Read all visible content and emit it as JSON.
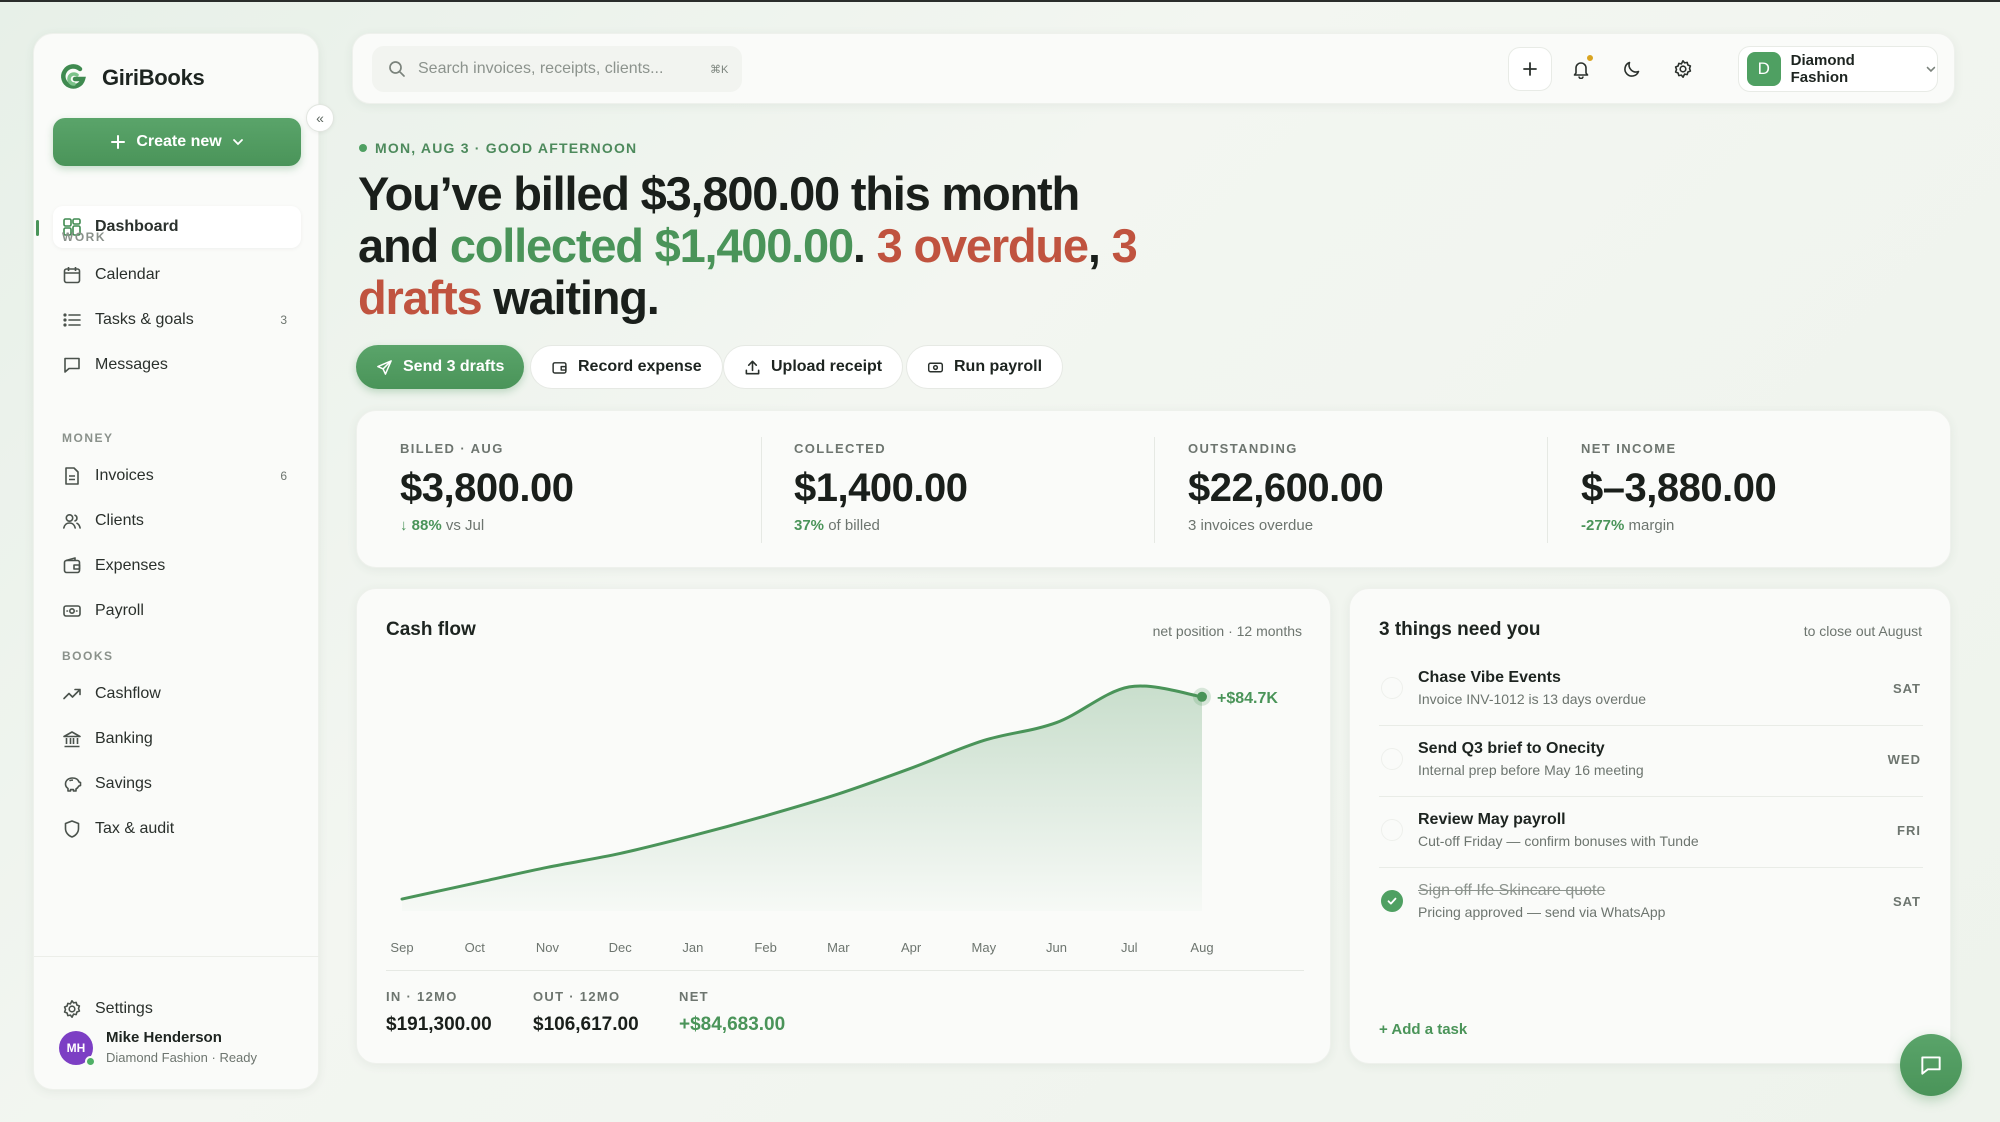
{
  "app": {
    "name": "GiriBooks"
  },
  "sidebar": {
    "create_label": "Create new",
    "sections": {
      "work": "WORK",
      "money": "MONEY",
      "books": "BOOKS"
    },
    "items": [
      {
        "label": "Dashboard",
        "icon": "dashboard-icon"
      },
      {
        "label": "Calendar",
        "icon": "calendar-icon"
      },
      {
        "label": "Tasks & goals",
        "icon": "list-icon",
        "count": "3"
      },
      {
        "label": "Messages",
        "icon": "message-icon"
      },
      {
        "label": "Invoices",
        "icon": "document-icon",
        "count": "6"
      },
      {
        "label": "Clients",
        "icon": "users-icon"
      },
      {
        "label": "Expenses",
        "icon": "wallet-icon"
      },
      {
        "label": "Payroll",
        "icon": "banknote-icon"
      },
      {
        "label": "Cashflow",
        "icon": "trend-icon"
      },
      {
        "label": "Banking",
        "icon": "bank-icon"
      },
      {
        "label": "Savings",
        "icon": "piggy-bank-icon"
      },
      {
        "label": "Tax & audit",
        "icon": "shield-icon"
      }
    ],
    "settings_label": "Settings",
    "user": {
      "initials": "MH",
      "name": "Mike Henderson",
      "subtitle": "Diamond Fashion · Ready"
    }
  },
  "topbar": {
    "search_placeholder": "Search invoices, receipts, clients...",
    "shortcut": "⌘K",
    "account": {
      "initial": "D",
      "name": "Diamond Fashion"
    }
  },
  "hero": {
    "greeting": "MON, AUG 3 · GOOD AFTERNOON",
    "line1": "You’ve billed $3,800.00 this month",
    "line2_pre": "and ",
    "collected": "collected $1,400.00",
    "sep1": ". ",
    "overdue": "3 overdue",
    "sep2": ", ",
    "drafts": "3 drafts",
    "line2_post": " waiting."
  },
  "actions": [
    {
      "label": "Send 3 drafts",
      "icon": "send-icon"
    },
    {
      "label": "Record expense",
      "icon": "wallet-icon"
    },
    {
      "label": "Upload receipt",
      "icon": "upload-icon"
    },
    {
      "label": "Run payroll",
      "icon": "banknote-icon"
    }
  ],
  "kpis": [
    {
      "label": "BILLED · AUG",
      "value": "$3,800.00",
      "sub_strong": "↓ 88%",
      "sub": " vs Jul"
    },
    {
      "label": "COLLECTED",
      "value": "$1,400.00",
      "sub_strong": "37%",
      "sub": " of billed"
    },
    {
      "label": "OUTSTANDING",
      "value": "$22,600.00",
      "sub_strong": "",
      "sub": "3 invoices overdue"
    },
    {
      "label": "NET INCOME",
      "value": "$–3,880.00",
      "sub_strong": "-277%",
      "sub": " margin"
    }
  ],
  "cashflow": {
    "title": "Cash flow",
    "note": "net position · 12 months",
    "end_label": "+$84.7K",
    "stats": [
      {
        "label": "IN · 12MO",
        "value": "$191,300.00"
      },
      {
        "label": "OUT · 12MO",
        "value": "$106,617.00"
      },
      {
        "label": "NET",
        "value": "+$84,683.00"
      }
    ]
  },
  "chart_data": {
    "type": "area",
    "title": "Cash flow",
    "subtitle": "net position · 12 months",
    "categories": [
      "Sep",
      "Oct",
      "Nov",
      "Dec",
      "Jan",
      "Feb",
      "Mar",
      "Apr",
      "May",
      "Jun",
      "Jul",
      "Aug"
    ],
    "series": [
      {
        "values": [
          -8,
          0,
          8,
          15,
          24,
          34,
          45,
          58,
          72,
          81,
          99,
          94
        ]
      }
    ],
    "end_annotation": "+$84.7K",
    "ylim": [
      -10,
      105
    ],
    "grid": false,
    "accent": "#4a9459"
  },
  "tasks": {
    "title": "3 things need you",
    "note": "to close out August",
    "items": [
      {
        "title": "Chase Vibe Events",
        "sub": "Invoice INV-1012 is 13 days overdue",
        "day": "SAT",
        "done": false
      },
      {
        "title": "Send Q3 brief to Onecity",
        "sub": "Internal prep before May 16 meeting",
        "day": "WED",
        "done": false
      },
      {
        "title": "Review May payroll",
        "sub": "Cut-off Friday — confirm bonuses with Tunde",
        "day": "FRI",
        "done": false
      },
      {
        "title": "Sign off Ife Skincare quote",
        "sub": "Pricing approved — send via WhatsApp",
        "day": "SAT",
        "done": true
      }
    ],
    "add_label": "+ Add a task"
  },
  "colors": {
    "accent": "#4a9459",
    "danger": "#c0533f",
    "warning": "#d9a420"
  }
}
